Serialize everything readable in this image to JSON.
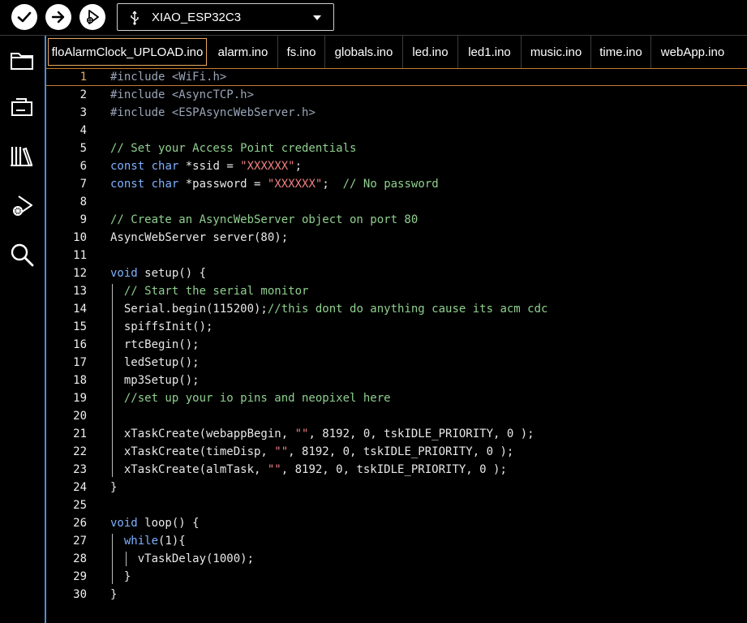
{
  "toolbar": {
    "verify_icon": "check-icon",
    "upload_icon": "arrow-right-icon",
    "debug_icon": "play-debug-icon",
    "board_name": "XIAO_ESP32C3"
  },
  "sidebar": {
    "items": [
      {
        "icon": "folder-icon",
        "name": "sketchbook"
      },
      {
        "icon": "board-icon",
        "name": "boards-manager"
      },
      {
        "icon": "library-icon",
        "name": "library-manager"
      },
      {
        "icon": "debug-icon",
        "name": "debug"
      },
      {
        "icon": "search-icon",
        "name": "search"
      }
    ]
  },
  "tabs": [
    {
      "label": "floAlarmClock_UPLOAD.ino",
      "active": true
    },
    {
      "label": "alarm.ino"
    },
    {
      "label": "fs.ino"
    },
    {
      "label": "globals.ino"
    },
    {
      "label": "led.ino"
    },
    {
      "label": "led1.ino"
    },
    {
      "label": "music.ino"
    },
    {
      "label": "time.ino"
    },
    {
      "label": "webApp.ino"
    }
  ],
  "editor": {
    "current_line": 1,
    "lines": [
      "#include <WiFi.h>",
      "#include <AsyncTCP.h>",
      "#include <ESPAsyncWebServer.h>",
      "",
      "// Set your Access Point credentials",
      "const char *ssid = \"XXXXXX\";",
      "const char *password = \"XXXXXX\";  // No password",
      "",
      "// Create an AsyncWebServer object on port 80",
      "AsyncWebServer server(80);",
      "",
      "void setup() {",
      "  // Start the serial monitor",
      "  Serial.begin(115200);//this dont do anything cause its acm cdc",
      "  spiffsInit();",
      "  rtcBegin();",
      "  ledSetup();",
      "  mp3Setup();",
      "  //set up your io pins and neopixel here",
      "",
      "  xTaskCreate(webappBegin, \"\", 8192, 0, tskIDLE_PRIORITY, 0 );",
      "  xTaskCreate(timeDisp, \"\", 8192, 0, tskIDLE_PRIORITY, 0 );",
      "  xTaskCreate(almTask, \"\", 8192, 0, tskIDLE_PRIORITY, 0 );",
      "}",
      "",
      "void loop() {",
      "  while(1){",
      "    vTaskDelay(1000);",
      "  }",
      "}"
    ]
  },
  "colors": {
    "accent_tab": "#e8a860",
    "editor_border": "#4a8fd6",
    "keyword": "#7fb0ff",
    "string": "#f08080",
    "comment": "#8fcf8f"
  }
}
